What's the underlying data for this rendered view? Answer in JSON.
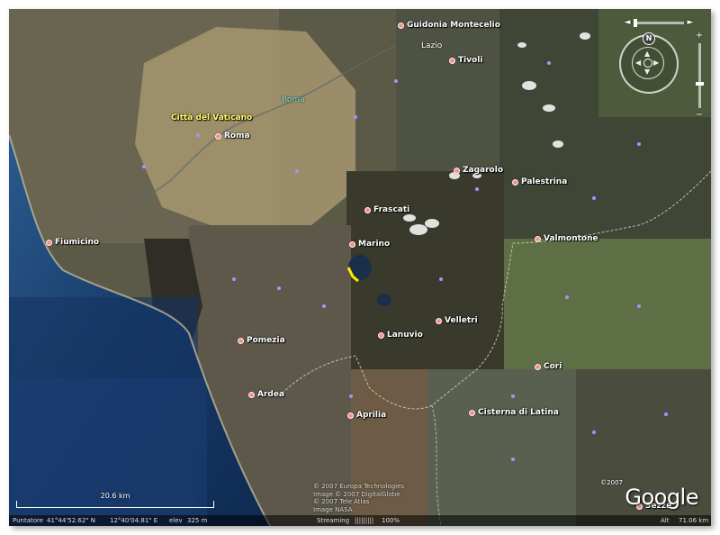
{
  "places": [
    {
      "id": "guidonia",
      "name": "Guidonia Montecelio"
    },
    {
      "id": "tivoli",
      "name": "Tivoli"
    },
    {
      "id": "roma",
      "name": "Roma"
    },
    {
      "id": "zagarolo",
      "name": "Zagarolo"
    },
    {
      "id": "palestrina",
      "name": "Palestrina"
    },
    {
      "id": "frascati",
      "name": "Frascati"
    },
    {
      "id": "fiumicino",
      "name": "Fiumicino"
    },
    {
      "id": "marino",
      "name": "Marino"
    },
    {
      "id": "valmontone",
      "name": "Valmontone"
    },
    {
      "id": "velletri",
      "name": "Velletri"
    },
    {
      "id": "lanuvio",
      "name": "Lanuvio"
    },
    {
      "id": "pomezia",
      "name": "Pomezia"
    },
    {
      "id": "cori",
      "name": "Cori"
    },
    {
      "id": "ardea",
      "name": "Ardea"
    },
    {
      "id": "aprilia",
      "name": "Aprilia"
    },
    {
      "id": "cisterna",
      "name": "Cisterna di Latina"
    },
    {
      "id": "sezze",
      "name": "Sezze"
    }
  ],
  "regions": {
    "lazio": "Lazio",
    "vatican": "Città del Vaticano",
    "roma_city": "Roma"
  },
  "navigation": {
    "north_label": "N"
  },
  "scale": {
    "label": "20.6 km"
  },
  "credits": [
    "© 2007 Europa Technologies",
    "Image © 2007 DigitalGlobe",
    "© 2007 Tele Atlas",
    "Image NASA"
  ],
  "logo": {
    "text": "Google",
    "year": "©2007"
  },
  "status": {
    "pointer_label": "Puntatore",
    "lat": "41°44'52.62\" N",
    "lon": "12°40'04.81\" E",
    "elev_label": "elev",
    "elev_value": "325 m",
    "streaming_label": "Streaming",
    "streaming_bar": "|||||||||",
    "streaming_percent": "100%",
    "alt_label": "Alt",
    "alt_value": "71.06 km"
  },
  "colors": {
    "place_dot": "#ff8a8a",
    "vatican_label": "#ffff66",
    "roma_city_label": "#7fe0d0",
    "sea": "#1d3f6e",
    "route": "#ffee00"
  }
}
